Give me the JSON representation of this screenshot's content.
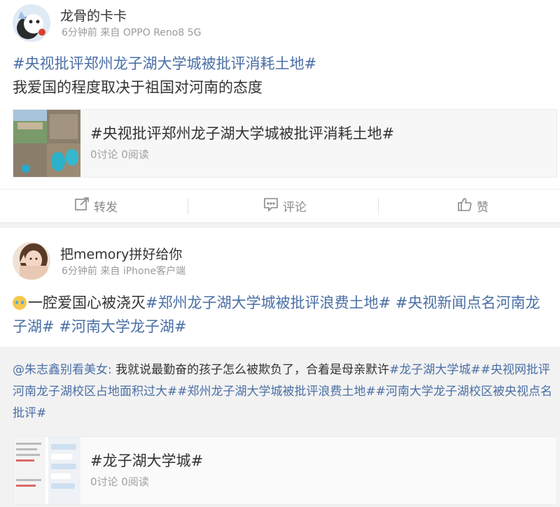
{
  "post1": {
    "username": "龙骨的卡卡",
    "time": "6分钟前",
    "source": "来自 OPPO Reno8 5G",
    "topic": "#央视批评郑州龙子湖大学城被批评消耗土地#",
    "text": "我爱国的程度取决于祖国对河南的态度",
    "link_card": {
      "title": "#央视批评郑州龙子湖大学城被批评消耗土地#",
      "stats": "0讨论 0阅读"
    },
    "actions": {
      "repost_label": "转发",
      "comment_label": "评论",
      "like_label": "赞"
    }
  },
  "post2": {
    "username": "把memory拼好给你",
    "time": "6分钟前",
    "source": "来自 iPhone客户端",
    "emoji": "crying-emoji",
    "text_start": "一腔爱国心被浇灭",
    "topic1": "#郑州龙子湖大学城被批评浪费土地#",
    "topic2": "#央视新闻点名河南龙子湖#",
    "topic3": "#河南大学龙子湖#",
    "repost": {
      "mention": "@朱志鑫别看美女",
      "separator": ": ",
      "text": "我就说最勤奋的孩子怎么被欺负了，合着是母亲默许",
      "topic1": "#龙子湖大学城#",
      "topic2": "#央视网批评河南龙子湖校区占地面积过大#",
      "topic3": "#郑州龙子湖大学城被批评浪费土地#",
      "topic4": "#河南大学龙子湖校区被央视点名批评#",
      "link_card": {
        "title": "#龙子湖大学城#",
        "stats": "0讨论 0阅读"
      }
    }
  },
  "colors": {
    "topic": "#4a6fa5",
    "meta": "#9a9a9a"
  }
}
